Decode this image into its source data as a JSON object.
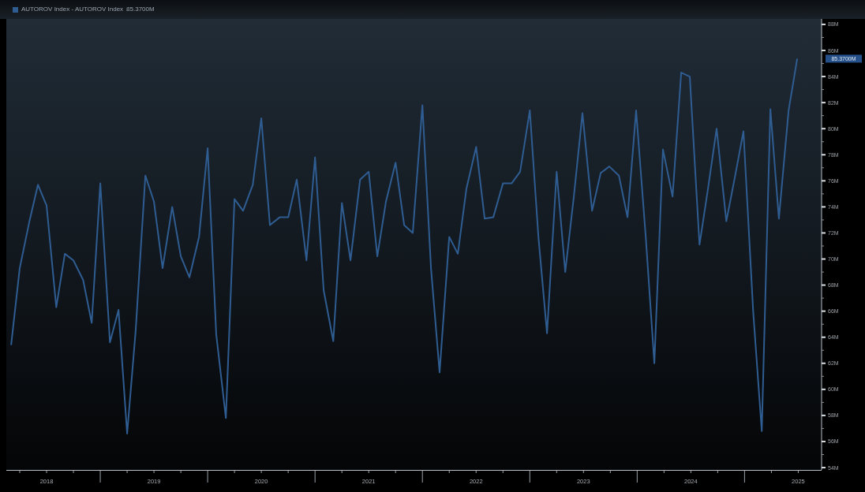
{
  "header": {
    "legend_value": "85.3700M"
  },
  "chart": {
    "chart_data": {
      "type": "line",
      "x": [
        2018.17,
        2018.25,
        2018.34,
        2018.42,
        2018.5,
        2018.59,
        2018.67,
        2018.75,
        2018.84,
        2018.92,
        2019.0,
        2019.09,
        2019.17,
        2019.25,
        2019.33,
        2019.42,
        2019.5,
        2019.58,
        2019.67,
        2019.75,
        2019.83,
        2019.92,
        2020.0,
        2020.08,
        2020.17,
        2020.25,
        2020.33,
        2020.42,
        2020.5,
        2020.58,
        2020.67,
        2020.75,
        2020.83,
        2020.92,
        2021.0,
        2021.08,
        2021.17,
        2021.25,
        2021.33,
        2021.42,
        2021.5,
        2021.58,
        2021.66,
        2021.75,
        2021.83,
        2021.91,
        2022.0,
        2022.08,
        2022.16,
        2022.25,
        2022.33,
        2022.41,
        2022.5,
        2022.58,
        2022.66,
        2022.75,
        2022.83,
        2022.91,
        2023.0,
        2023.08,
        2023.16,
        2023.25,
        2023.33,
        2023.41,
        2023.49,
        2023.58,
        2023.66,
        2023.74,
        2023.83,
        2023.91,
        2023.99,
        2024.08,
        2024.16,
        2024.24,
        2024.33,
        2024.41,
        2024.49,
        2024.58,
        2024.66,
        2024.74,
        2024.83,
        2024.91,
        2024.99,
        2025.08,
        2025.16,
        2025.24,
        2025.32,
        2025.41,
        2025.49
      ],
      "series": [
        {
          "name": "AUTOROV Index - AUTOROV Index",
          "color": "#2f5d92",
          "values": [
            63.4,
            69.3,
            72.9,
            75.7,
            74.1,
            66.3,
            70.4,
            69.9,
            68.4,
            65.1,
            75.8,
            63.6,
            66.1,
            56.6,
            64.5,
            76.4,
            74.4,
            69.3,
            74.0,
            70.2,
            68.6,
            71.7,
            78.5,
            64.2,
            57.8,
            74.6,
            73.7,
            75.7,
            80.8,
            72.6,
            73.2,
            73.2,
            76.1,
            69.9,
            77.8,
            67.6,
            63.7,
            74.3,
            69.9,
            76.1,
            76.7,
            70.2,
            74.4,
            77.4,
            72.6,
            72.0,
            81.8,
            69.3,
            61.3,
            71.7,
            70.4,
            75.4,
            78.6,
            73.1,
            73.2,
            75.8,
            75.8,
            76.7,
            81.4,
            71.7,
            64.3,
            76.7,
            69.0,
            74.8,
            81.2,
            73.7,
            76.6,
            77.1,
            76.4,
            73.2,
            81.4,
            71.7,
            62.0,
            78.4,
            74.8,
            84.3,
            84.0,
            71.1,
            75.4,
            80.0,
            72.9,
            76.3,
            79.8,
            66.0,
            56.8,
            81.5,
            73.1,
            81.4,
            85.37
          ]
        }
      ],
      "xlim": [
        2018.125,
        2025.71
      ],
      "ylim": [
        53.82,
        88.42
      ],
      "xticks": [
        {
          "value": 2018.5,
          "label": "2018"
        },
        {
          "value": 2019.5,
          "label": "2019"
        },
        {
          "value": 2020.5,
          "label": "2020"
        },
        {
          "value": 2021.5,
          "label": "2021"
        },
        {
          "value": 2022.5,
          "label": "2022"
        },
        {
          "value": 2023.5,
          "label": "2023"
        },
        {
          "value": 2024.5,
          "label": "2024"
        },
        {
          "value": 2025.5,
          "label": "2025"
        }
      ],
      "yticks": [
        {
          "value": 54,
          "label": "54M"
        },
        {
          "value": 56,
          "label": "56M"
        },
        {
          "value": 58,
          "label": "58M"
        },
        {
          "value": 60,
          "label": "60M"
        },
        {
          "value": 62,
          "label": "62M"
        },
        {
          "value": 64,
          "label": "64M"
        },
        {
          "value": 66,
          "label": "66M"
        },
        {
          "value": 68,
          "label": "68M"
        },
        {
          "value": 70,
          "label": "70M"
        },
        {
          "value": 72,
          "label": "72M"
        },
        {
          "value": 74,
          "label": "74M"
        },
        {
          "value": 76,
          "label": "76M"
        },
        {
          "value": 78,
          "label": "78M"
        },
        {
          "value": 80,
          "label": "80M"
        },
        {
          "value": 82,
          "label": "82M"
        },
        {
          "value": 84,
          "label": "84M"
        },
        {
          "value": 86,
          "label": "86M"
        },
        {
          "value": 88,
          "label": "88M"
        }
      ],
      "annotations": [
        "85.3700M"
      ]
    }
  }
}
